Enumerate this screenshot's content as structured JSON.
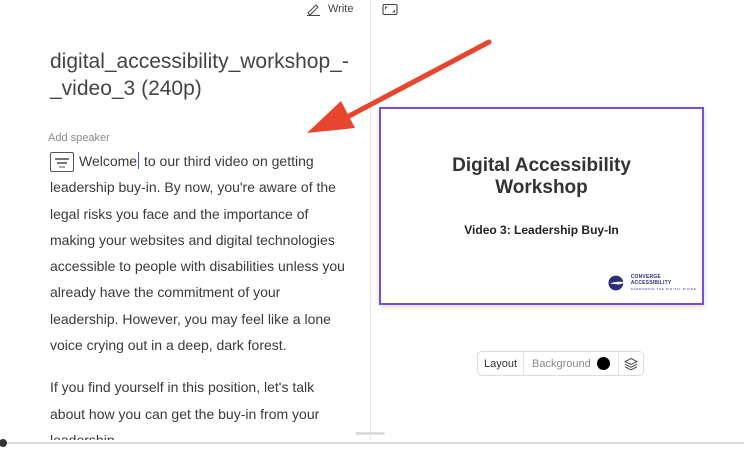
{
  "header": {
    "write_label": "Write"
  },
  "document": {
    "title": "digital_accessibility_workshop_-_video_3 (240p)",
    "speaker_label": "Add speaker",
    "paragraph1_before_caret": "Welcome",
    "paragraph1_after_caret": " to our third video on getting leadership buy-in. By now, you're aware of the legal risks you face and the importance of making your websites and digital technologies accessible to people with disabilities unless you already have the commitment of your leadership. However, you may feel like a lone voice crying out in a deep, dark forest.",
    "paragraph2": "If you find yourself in this position, let's talk about how you can get the buy-in from your leadership."
  },
  "slide": {
    "title_line1": "Digital Accessibility",
    "title_line2": "Workshop",
    "subtitle": "Video 3: Leadership Buy-In",
    "brand_name": "CONVERGE ACCESSIBILITY",
    "brand_tagline": "NARROWING THE DIGITAL DIVIDE"
  },
  "toolbar": {
    "layout_label": "Layout",
    "background_label": "Background",
    "background_color": "#000000"
  },
  "colors": {
    "accent_frame": "#7c4dcc",
    "annotation_arrow": "#e8452e",
    "caret": "#3a5bd9"
  },
  "playback": {
    "progress": 0.0
  }
}
